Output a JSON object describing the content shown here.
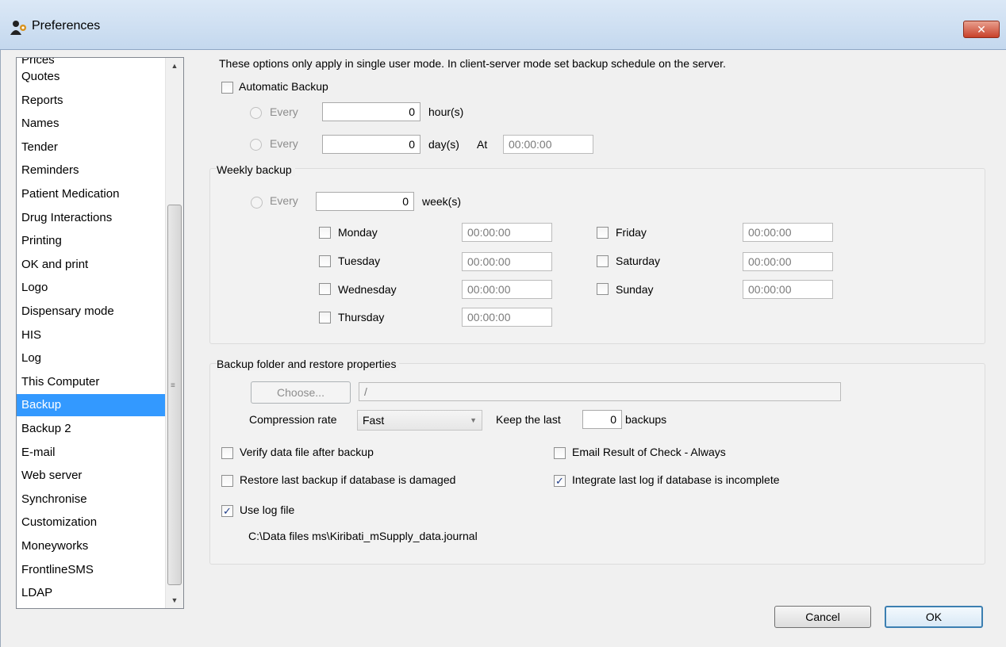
{
  "window": {
    "title": "Preferences",
    "close_glyph": "✕"
  },
  "sidebar": {
    "partial_top_item": "Prices",
    "items": [
      "Quotes",
      "Reports",
      "Names",
      "Tender",
      "Reminders",
      "Patient Medication",
      "Drug Interactions",
      "Printing",
      "OK and print",
      "Logo",
      "Dispensary mode",
      "HIS",
      "Log",
      "This Computer",
      "Backup",
      "Backup 2",
      "E-mail",
      "Web server",
      "Synchronise",
      "Customization",
      "Moneyworks",
      "FrontlineSMS",
      "LDAP"
    ],
    "selected": "Backup"
  },
  "backup": {
    "note": "These options only apply in single user mode. In client-server mode set backup schedule on the server.",
    "automatic_backup": {
      "label": "Automatic Backup",
      "checked": false
    },
    "every_hours": {
      "label": "Every",
      "value": "0",
      "unit": "hour(s)"
    },
    "every_days": {
      "label": "Every",
      "value": "0",
      "unit": "day(s)",
      "at_label": "At",
      "at_value": "00:00:00"
    },
    "weekly": {
      "title": "Weekly backup",
      "every_label": "Every",
      "every_value": "0",
      "unit": "week(s)",
      "days": [
        {
          "name": "Monday",
          "time": "00:00:00",
          "checked": false
        },
        {
          "name": "Tuesday",
          "time": "00:00:00",
          "checked": false
        },
        {
          "name": "Wednesday",
          "time": "00:00:00",
          "checked": false
        },
        {
          "name": "Thursday",
          "time": "00:00:00",
          "checked": false
        },
        {
          "name": "Friday",
          "time": "00:00:00",
          "checked": false
        },
        {
          "name": "Saturday",
          "time": "00:00:00",
          "checked": false
        },
        {
          "name": "Sunday",
          "time": "00:00:00",
          "checked": false
        }
      ]
    },
    "folder": {
      "title": "Backup folder and restore properties",
      "choose_label": "Choose...",
      "path": "/",
      "compression_label": "Compression rate",
      "compression_value": "Fast",
      "keep_label": "Keep the last",
      "keep_value": "0",
      "keep_suffix": "backups",
      "verify": {
        "label": "Verify data file after backup",
        "checked": false
      },
      "restore": {
        "label": "Restore last backup if database is damaged",
        "checked": false
      },
      "email_result": {
        "label": "Email Result of Check - Always",
        "checked": false
      },
      "integrate_log": {
        "label": "Integrate last log if database is incomplete",
        "checked": true
      },
      "use_log": {
        "label": "Use log file",
        "checked": true
      },
      "log_path": "C:\\Data files ms\\Kiribati_mSupply_data.journal"
    }
  },
  "buttons": {
    "cancel": "Cancel",
    "ok": "OK"
  },
  "icons": {
    "window_icon": "people-gear-icon",
    "checkmark": "✓"
  }
}
